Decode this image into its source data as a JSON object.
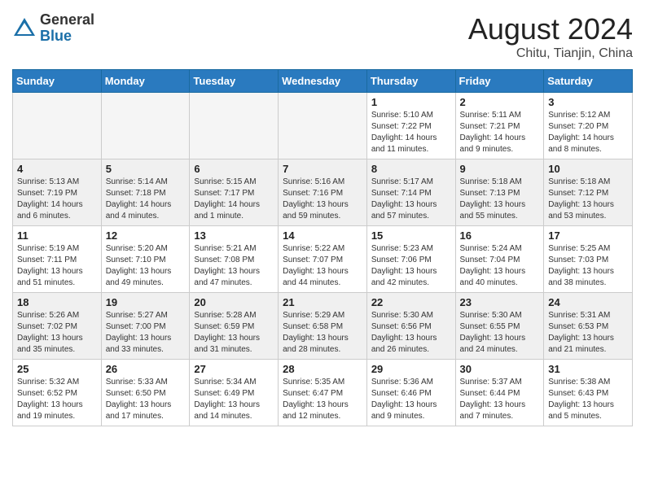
{
  "header": {
    "logo_general": "General",
    "logo_blue": "Blue",
    "month_title": "August 2024",
    "location": "Chitu, Tianjin, China"
  },
  "weekdays": [
    "Sunday",
    "Monday",
    "Tuesday",
    "Wednesday",
    "Thursday",
    "Friday",
    "Saturday"
  ],
  "weeks": [
    [
      {
        "day": "",
        "info": ""
      },
      {
        "day": "",
        "info": ""
      },
      {
        "day": "",
        "info": ""
      },
      {
        "day": "",
        "info": ""
      },
      {
        "day": "1",
        "info": "Sunrise: 5:10 AM\nSunset: 7:22 PM\nDaylight: 14 hours\nand 11 minutes."
      },
      {
        "day": "2",
        "info": "Sunrise: 5:11 AM\nSunset: 7:21 PM\nDaylight: 14 hours\nand 9 minutes."
      },
      {
        "day": "3",
        "info": "Sunrise: 5:12 AM\nSunset: 7:20 PM\nDaylight: 14 hours\nand 8 minutes."
      }
    ],
    [
      {
        "day": "4",
        "info": "Sunrise: 5:13 AM\nSunset: 7:19 PM\nDaylight: 14 hours\nand 6 minutes."
      },
      {
        "day": "5",
        "info": "Sunrise: 5:14 AM\nSunset: 7:18 PM\nDaylight: 14 hours\nand 4 minutes."
      },
      {
        "day": "6",
        "info": "Sunrise: 5:15 AM\nSunset: 7:17 PM\nDaylight: 14 hours\nand 1 minute."
      },
      {
        "day": "7",
        "info": "Sunrise: 5:16 AM\nSunset: 7:16 PM\nDaylight: 13 hours\nand 59 minutes."
      },
      {
        "day": "8",
        "info": "Sunrise: 5:17 AM\nSunset: 7:14 PM\nDaylight: 13 hours\nand 57 minutes."
      },
      {
        "day": "9",
        "info": "Sunrise: 5:18 AM\nSunset: 7:13 PM\nDaylight: 13 hours\nand 55 minutes."
      },
      {
        "day": "10",
        "info": "Sunrise: 5:18 AM\nSunset: 7:12 PM\nDaylight: 13 hours\nand 53 minutes."
      }
    ],
    [
      {
        "day": "11",
        "info": "Sunrise: 5:19 AM\nSunset: 7:11 PM\nDaylight: 13 hours\nand 51 minutes."
      },
      {
        "day": "12",
        "info": "Sunrise: 5:20 AM\nSunset: 7:10 PM\nDaylight: 13 hours\nand 49 minutes."
      },
      {
        "day": "13",
        "info": "Sunrise: 5:21 AM\nSunset: 7:08 PM\nDaylight: 13 hours\nand 47 minutes."
      },
      {
        "day": "14",
        "info": "Sunrise: 5:22 AM\nSunset: 7:07 PM\nDaylight: 13 hours\nand 44 minutes."
      },
      {
        "day": "15",
        "info": "Sunrise: 5:23 AM\nSunset: 7:06 PM\nDaylight: 13 hours\nand 42 minutes."
      },
      {
        "day": "16",
        "info": "Sunrise: 5:24 AM\nSunset: 7:04 PM\nDaylight: 13 hours\nand 40 minutes."
      },
      {
        "day": "17",
        "info": "Sunrise: 5:25 AM\nSunset: 7:03 PM\nDaylight: 13 hours\nand 38 minutes."
      }
    ],
    [
      {
        "day": "18",
        "info": "Sunrise: 5:26 AM\nSunset: 7:02 PM\nDaylight: 13 hours\nand 35 minutes."
      },
      {
        "day": "19",
        "info": "Sunrise: 5:27 AM\nSunset: 7:00 PM\nDaylight: 13 hours\nand 33 minutes."
      },
      {
        "day": "20",
        "info": "Sunrise: 5:28 AM\nSunset: 6:59 PM\nDaylight: 13 hours\nand 31 minutes."
      },
      {
        "day": "21",
        "info": "Sunrise: 5:29 AM\nSunset: 6:58 PM\nDaylight: 13 hours\nand 28 minutes."
      },
      {
        "day": "22",
        "info": "Sunrise: 5:30 AM\nSunset: 6:56 PM\nDaylight: 13 hours\nand 26 minutes."
      },
      {
        "day": "23",
        "info": "Sunrise: 5:30 AM\nSunset: 6:55 PM\nDaylight: 13 hours\nand 24 minutes."
      },
      {
        "day": "24",
        "info": "Sunrise: 5:31 AM\nSunset: 6:53 PM\nDaylight: 13 hours\nand 21 minutes."
      }
    ],
    [
      {
        "day": "25",
        "info": "Sunrise: 5:32 AM\nSunset: 6:52 PM\nDaylight: 13 hours\nand 19 minutes."
      },
      {
        "day": "26",
        "info": "Sunrise: 5:33 AM\nSunset: 6:50 PM\nDaylight: 13 hours\nand 17 minutes."
      },
      {
        "day": "27",
        "info": "Sunrise: 5:34 AM\nSunset: 6:49 PM\nDaylight: 13 hours\nand 14 minutes."
      },
      {
        "day": "28",
        "info": "Sunrise: 5:35 AM\nSunset: 6:47 PM\nDaylight: 13 hours\nand 12 minutes."
      },
      {
        "day": "29",
        "info": "Sunrise: 5:36 AM\nSunset: 6:46 PM\nDaylight: 13 hours\nand 9 minutes."
      },
      {
        "day": "30",
        "info": "Sunrise: 5:37 AM\nSunset: 6:44 PM\nDaylight: 13 hours\nand 7 minutes."
      },
      {
        "day": "31",
        "info": "Sunrise: 5:38 AM\nSunset: 6:43 PM\nDaylight: 13 hours\nand 5 minutes."
      }
    ]
  ]
}
